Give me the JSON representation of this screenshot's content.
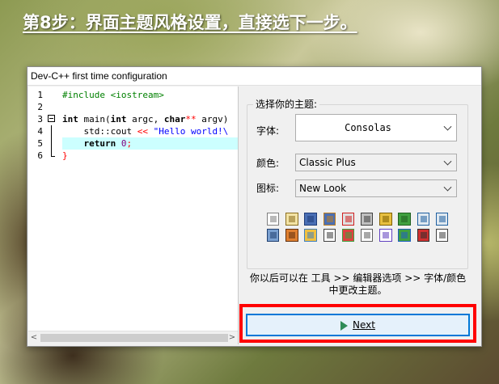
{
  "heading": "第8步：界面主题风格设置，直接选下一步。",
  "window": {
    "title": "Dev-C++ first time configuration"
  },
  "editor": {
    "lines": [
      {
        "num": "1",
        "tokens": [
          {
            "t": "#include <iostream>",
            "c": "pp"
          }
        ]
      },
      {
        "num": "2",
        "tokens": []
      },
      {
        "num": "3",
        "tokens": [
          {
            "t": "int",
            "c": "kw"
          },
          {
            "t": " main(",
            "c": "plain"
          },
          {
            "t": "int",
            "c": "kw"
          },
          {
            "t": " argc, ",
            "c": "plain"
          },
          {
            "t": "char",
            "c": "kw"
          },
          {
            "t": "**",
            "c": "op"
          },
          {
            "t": " argv)",
            "c": "plain"
          }
        ]
      },
      {
        "num": "4",
        "tokens": [
          {
            "t": "    std::cout ",
            "c": "plain"
          },
          {
            "t": "<<",
            "c": "op"
          },
          {
            "t": " \"Hello world!\\",
            "c": "str"
          }
        ]
      },
      {
        "num": "5",
        "tokens": [
          {
            "t": "    ",
            "c": "plain"
          },
          {
            "t": "return",
            "c": "kw"
          },
          {
            "t": " ",
            "c": "plain"
          },
          {
            "t": "0",
            "c": "num"
          },
          {
            "t": ";",
            "c": "op"
          }
        ]
      },
      {
        "num": "6",
        "tokens": [
          {
            "t": "}",
            "c": "op"
          }
        ]
      }
    ]
  },
  "theme": {
    "group_title": "选择你的主题:",
    "font_label": "字体:",
    "font_value": "Consolas",
    "color_label": "颜色:",
    "color_value": "Classic Plus",
    "icon_label": "图标:",
    "icon_value": "New Look",
    "hint": "你以后可以在 工具 >> 编辑器选项 >> 字体/颜色 中更改主题。"
  },
  "toolbar_icons": {
    "row1": [
      "new-file-icon",
      "new-project-icon",
      "save-icon",
      "save-all-icon",
      "close-icon",
      "print-icon",
      "undo-icon",
      "redo-icon",
      "find-icon",
      "replace-icon"
    ],
    "row2": [
      "compile-icon",
      "run-icon",
      "grid-icon",
      "window-icon",
      "colors-icon",
      "layout-icon",
      "check-icon",
      "chart-icon",
      "debug-icon",
      "exit-icon"
    ]
  },
  "next_button": {
    "label": "Next"
  },
  "colors": {
    "accent": "#0078d7",
    "highlight_box": "#ff0000",
    "current_line": "#ccffff"
  }
}
